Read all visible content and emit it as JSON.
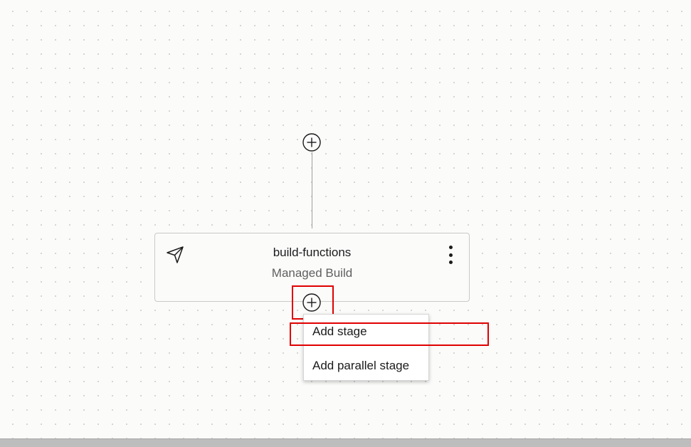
{
  "pipeline": {
    "top_add_button": {
      "icon": "plus-circle-icon"
    },
    "stage": {
      "icon": "send-icon",
      "title": "build-functions",
      "subtitle": "Managed Build",
      "menu_icon": "more-vertical-icon"
    },
    "stage_add_button": {
      "icon": "plus-circle-icon"
    }
  },
  "dropdown": {
    "items": [
      {
        "label": "Add stage"
      },
      {
        "label": "Add parallel stage"
      }
    ]
  },
  "colors": {
    "highlight": "#e00000",
    "background": "#fbfbfa",
    "line": "#9e9e9e"
  }
}
